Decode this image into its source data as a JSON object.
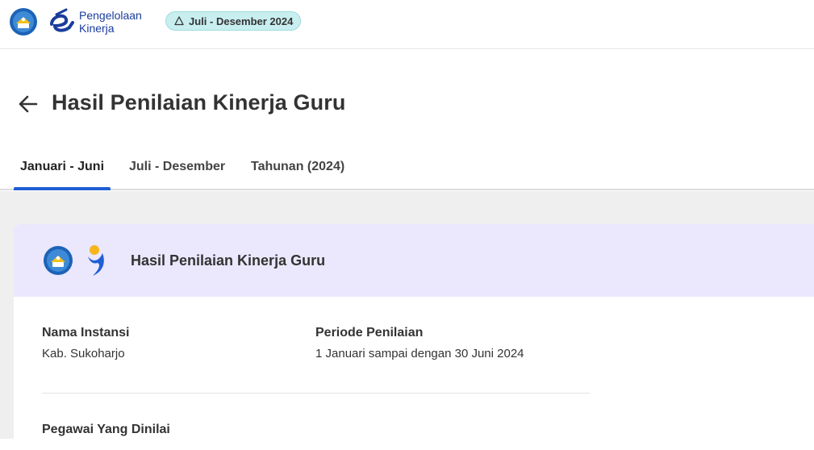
{
  "header": {
    "brand_line1": "Pengelolaan",
    "brand_line2": "Kinerja",
    "period_badge": "Juli - Desember 2024",
    "period_icon": "warning-triangle-icon"
  },
  "page": {
    "title": "Hasil Penilaian Kinerja Guru",
    "back_icon": "arrow-left-icon"
  },
  "tabs": [
    {
      "label": "Januari - Juni",
      "active": true
    },
    {
      "label": "Juli - Desember",
      "active": false
    },
    {
      "label": "Tahunan (2024)",
      "active": false
    }
  ],
  "card": {
    "title": "Hasil Penilaian Kinerja Guru",
    "fields": {
      "instansi_label": "Nama Instansi",
      "instansi_value": "Kab. Sukoharjo",
      "periode_label": "Periode Penilaian",
      "periode_value": "1 Januari sampai dengan 30 Juni 2024",
      "pegawai_label": "Pegawai Yang Dinilai"
    }
  },
  "colors": {
    "accent": "#1f5fd6",
    "badge_bg": "#c8eef0",
    "card_header_bg": "#ebe7fd",
    "content_bg": "#efefef"
  }
}
